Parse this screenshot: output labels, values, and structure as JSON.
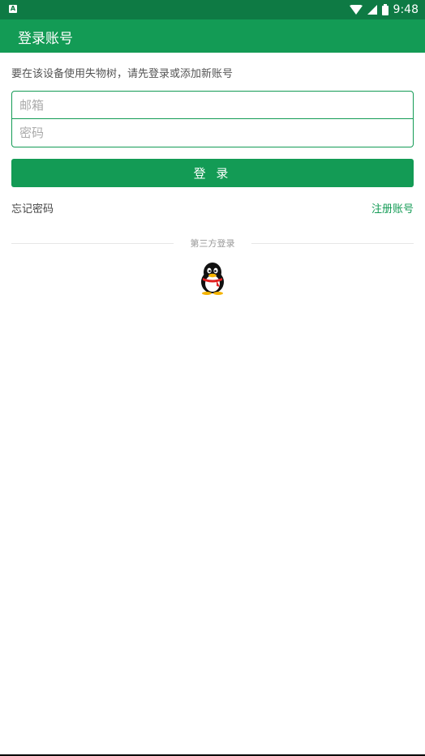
{
  "status": {
    "time": "9:48"
  },
  "appbar": {
    "title": "登录账号"
  },
  "hint": "要在该设备使用失物树，请先登录或添加新账号",
  "form": {
    "email_placeholder": "邮箱",
    "password_placeholder": "密码"
  },
  "login_button": "登 录",
  "links": {
    "forgot": "忘记密码",
    "register": "注册账号"
  },
  "third_party": {
    "label": "第三方登录",
    "icon": "qq-icon"
  },
  "colors": {
    "primary": "#139b55",
    "status_bar": "#0e7a44"
  }
}
